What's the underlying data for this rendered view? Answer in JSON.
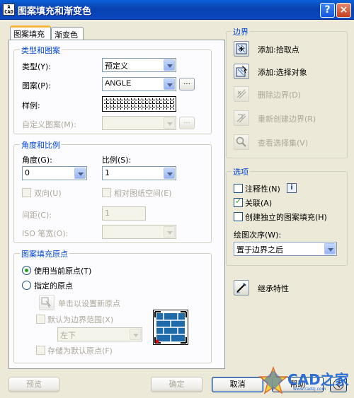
{
  "window": {
    "title": "图案填充和渐变色",
    "help_symbol": "?",
    "close_symbol": "×"
  },
  "tabs": [
    {
      "label": "图案填充",
      "active": true
    },
    {
      "label": "渐变色",
      "active": false
    }
  ],
  "type_pattern": {
    "title": "类型和图案",
    "type_label": "类型(Y):",
    "type_value": "预定义",
    "pattern_label": "图案(P):",
    "pattern_value": "ANGLE",
    "browse_label": "...",
    "sample_label": "样例:",
    "custom_label": "自定义图案(M):",
    "custom_value": "",
    "custom_browse_label": "..."
  },
  "angle_scale": {
    "title": "角度和比例",
    "angle_label": "角度(G):",
    "angle_value": "0",
    "scale_label": "比例(S):",
    "scale_value": "1",
    "double_label": "双向(U)",
    "relative_label": "相对图纸空间(E)",
    "spacing_label": "间距(C):",
    "spacing_value": "1",
    "iso_label": "ISO 笔宽(O):",
    "iso_value": ""
  },
  "origin": {
    "title": "图案填充原点",
    "use_current_label": "使用当前原点(T)",
    "specified_label": "指定的原点",
    "click_label": "单击以设置新原点",
    "default_extent_label": "默认为边界范围(X)",
    "position_value": "左下",
    "store_label": "存储为默认原点(F)"
  },
  "boundaries": {
    "title": "边界",
    "items": [
      {
        "label": "添加:拾取点",
        "enabled": true,
        "icon": "pick-points-icon"
      },
      {
        "label": "添加:选择对象",
        "enabled": true,
        "icon": "select-objects-icon"
      },
      {
        "label": "删除边界(D)",
        "enabled": false,
        "icon": "remove-boundaries-icon"
      },
      {
        "label": "重新创建边界(R)",
        "enabled": false,
        "icon": "recreate-boundary-icon"
      },
      {
        "label": "查看选择集(V)",
        "enabled": false,
        "icon": "view-selections-icon"
      }
    ]
  },
  "options": {
    "title": "选项",
    "annotative_label": "注释性(N)",
    "annotative_checked": false,
    "info_symbol": "i",
    "associative_label": "关联(A)",
    "associative_checked": true,
    "separate_label": "创建独立的图案填充(H)",
    "separate_checked": false,
    "draw_order_label": "绘图次序(W):",
    "draw_order_value": "置于边界之后"
  },
  "inherit": {
    "label": "继承特性"
  },
  "buttons": {
    "preview": "预览",
    "ok": "确定",
    "cancel": "取消",
    "help": "帮助"
  },
  "watermark": {
    "text": "CAD之家",
    "url": "www.cadzj.com"
  },
  "colors": {
    "title_bar": "#0842b0",
    "dialog_bg": "#ece9d8",
    "group_title": "#0046d5",
    "check_green": "#21a121"
  }
}
